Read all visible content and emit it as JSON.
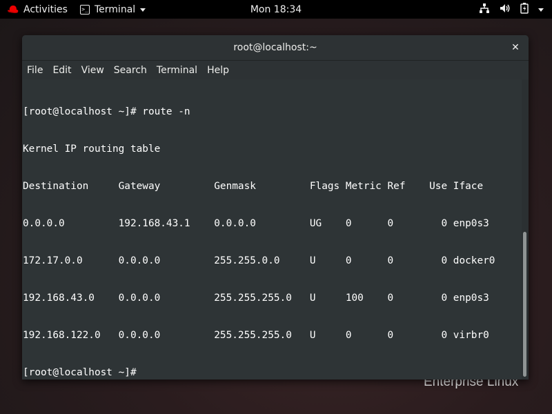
{
  "topbar": {
    "activities_label": "Activities",
    "app_name": "Terminal",
    "clock": "Mon 18:34"
  },
  "brand_text": "Enterprise Linux",
  "window": {
    "title": "root@localhost:~",
    "close_glyph": "✕",
    "menu": [
      "File",
      "Edit",
      "View",
      "Search",
      "Terminal",
      "Help"
    ]
  },
  "terminal": {
    "lines": [
      "[root@localhost ~]# route -n",
      "Kernel IP routing table",
      "Destination     Gateway         Genmask         Flags Metric Ref    Use Iface",
      "0.0.0.0         192.168.43.1    0.0.0.0         UG    0      0        0 enp0s3",
      "172.17.0.0      0.0.0.0         255.255.0.0     U     0      0        0 docker0",
      "192.168.43.0    0.0.0.0         255.255.255.0   U     100    0        0 enp0s3",
      "192.168.122.0   0.0.0.0         255.255.255.0   U     0      0        0 virbr0",
      "[root@localhost ~]# "
    ]
  },
  "icons": {
    "activities": "redhat-icon",
    "app": "terminal-icon",
    "network": "network-icon",
    "volume": "volume-icon",
    "battery": "battery-icon",
    "system_menu": "chevron-down-icon"
  }
}
